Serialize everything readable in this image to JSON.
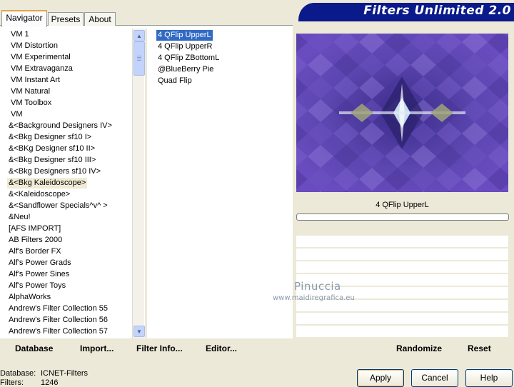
{
  "window": {
    "title": "Filters Unlimited 2.0"
  },
  "tabs": [
    {
      "label": "Navigator",
      "active": true
    },
    {
      "label": "Presets",
      "active": false
    },
    {
      "label": "About",
      "active": false
    }
  ],
  "categories": [
    "VM 1",
    "VM Distortion",
    "VM Experimental",
    "VM Extravaganza",
    "VM Instant Art",
    "VM Natural",
    "VM Toolbox",
    "VM",
    "&<Background Designers IV>",
    "&<Bkg Designer sf10 I>",
    "&<BKg Designer sf10 II>",
    "&<Bkg Designer sf10 III>",
    "&<Bkg Designers sf10 IV>",
    "&<Bkg Kaleidoscope>",
    "&<Kaleidoscope>",
    "&<Sandflower Specials^v^ >",
    "&Neu!",
    "[AFS IMPORT]",
    "AB Filters 2000",
    "Alf's Border FX",
    "Alf's Power Grads",
    "Alf's Power Sines",
    "Alf's Power Toys",
    "AlphaWorks",
    "Andrew's Filter Collection 55",
    "Andrew's Filter Collection 56",
    "Andrew's Filter Collection 57"
  ],
  "selected_category": "&<Bkg Kaleidoscope>",
  "filters": [
    "4 QFlip UpperL",
    "4 QFlip UpperR",
    "4 QFlip ZBottomL",
    "@BlueBerry Pie",
    "Quad Flip"
  ],
  "selected_filter": "4 QFlip UpperL",
  "preview": {
    "filter_name": "4 QFlip UpperL",
    "progress": 0,
    "colors": [
      "#5a3aa8",
      "#8d77d6",
      "#c7ddec",
      "#9fa37a",
      "#2a1f6a"
    ]
  },
  "left_buttons": {
    "database": "Database",
    "import": "Import...",
    "filter_info": "Filter Info...",
    "editor": "Editor..."
  },
  "right_buttons": {
    "randomize": "Randomize",
    "reset": "Reset"
  },
  "watermark": {
    "line1": "Pinuccia",
    "line2": "www.maidiregrafica.eu"
  },
  "status": {
    "database_label": "Database:",
    "database_value": "ICNET-Filters",
    "filters_label": "Filters:",
    "filters_value": "1246"
  },
  "dialog_buttons": {
    "apply": "Apply",
    "cancel": "Cancel",
    "help": "Help"
  }
}
